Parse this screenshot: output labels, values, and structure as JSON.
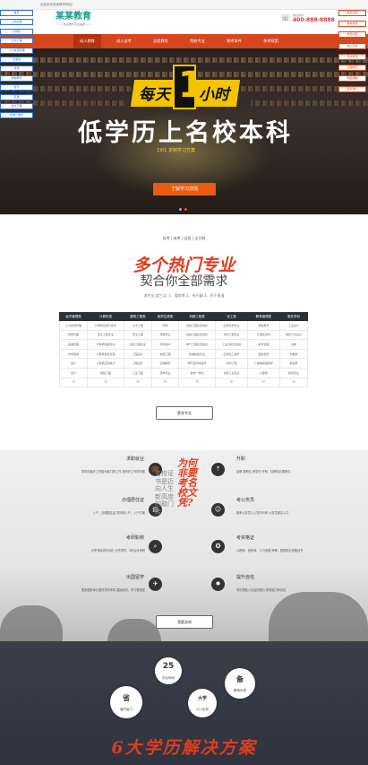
{
  "topbar": {
    "text": "欢迎来到某某教育网站!"
  },
  "header": {
    "logo_name": "某某教育",
    "logo_tagline": "—— 职业教育专业品牌 ——",
    "phone_label": "报名热线:",
    "phone_number": "400-888-8888"
  },
  "nav": {
    "items": [
      "成人教育",
      "成人自考",
      "远程教育",
      "院校专业",
      "报考条件",
      "免考政策"
    ]
  },
  "side_left": [
    "首页",
    "工商管理",
    "计算机",
    "土木工程",
    "人力资源管理",
    "汉语言",
    "法律",
    "学前教育",
    "会计",
    "英语",
    "会计工程",
    "机电一体化"
  ],
  "side_right": [
    "报名流程",
    "报考指南",
    "常见问题",
    "成人高考",
    "自学考试",
    "远程教育",
    "网络课程",
    "联系我们"
  ],
  "hero": {
    "line1a": "每天",
    "line1_one": "1",
    "line1b": "小时",
    "line2": "低学历上名校本科",
    "line3": "1对1 定制学习方案",
    "button": "了解学习详情"
  },
  "section2": {
    "sub_links": "自考 | 成考 | 远程 | 全日制",
    "title": "多个热门专业",
    "subtitle": "契合你全部需求",
    "desc": "选专业,就三点: 1、看前考 2、有兴趣 3、利于晋道",
    "headers": [
      "经济管理类",
      "计算机类",
      "建筑工程类",
      "医药生健类",
      "机械工程类",
      "化工类",
      "教育管理类",
      "更多学科"
    ],
    "rows": [
      [
        "人力资源管理",
        "计算机应用与技术",
        "土木工程",
        "药学",
        "机械工程及自动化",
        "应用化学专业",
        "学前教育",
        "工业设计"
      ],
      [
        "财务管理",
        "电子工程专业",
        "安全工程",
        "药物专业",
        "机械工程及自动化",
        "化学工程专业",
        "汉语言文学",
        "电影艺术设计"
      ],
      [
        "金融管理",
        "计算机网络专业",
        "建筑工程专业",
        "药学技术",
        "电气工程及自动化",
        "工业分析与检验",
        "教育管理",
        "法律"
      ],
      [
        "市场营销",
        "计算机信息管理",
        "工程设计",
        "制药工程",
        "机械制造专业",
        "应用化工技术",
        "国际教育",
        "护理学"
      ],
      [
        "会计",
        "计算机应用技术",
        "工程设计",
        "生物制药",
        "电气自动化技术",
        "化学工程",
        "广播电视编辑学",
        "英语学"
      ],
      [
        "会计",
        "网络工程",
        "工业工程",
        "药学专业",
        "机电一体化",
        "化学工业专业",
        "心理学",
        "新闻专业"
      ]
    ],
    "icons": [
      "⊕",
      "⊕",
      "⊕",
      "⊕",
      "⊕",
      "⊕",
      "⊕",
      "⊕"
    ],
    "button": "更多专业"
  },
  "section3": {
    "center_title": "为何非要考名校文凭?",
    "center_sub": "名校证书是迈向人生新高度的敲门砖",
    "left": [
      {
        "title": "求职就业",
        "desc": "求学的最好工作因为敲门砖工作 找份好工作的时候"
      },
      {
        "title": "办理居住证",
        "desc": "入户、办理居住证 学历和入户、入户方案"
      },
      {
        "title": "考研职称",
        "desc": "大学专科学历可在 大学学历、2年后可考研"
      },
      {
        "title": "出国留学",
        "desc": "很多国家承认国内学历本科 直接面试、学习很轻松"
      }
    ],
    "right": [
      {
        "title": "升职",
        "desc": "加薪 提职位,有学历 升职、加薪的必要条件"
      },
      {
        "title": "考公务员",
        "desc": "报考公务员以上学历可考 公务员报名入口"
      },
      {
        "title": "考资格证",
        "desc": "心理师、营养师、人力资源 师等、国家职业资格证书"
      },
      {
        "title": "提升自信",
        "desc": "学历是融入社会的基石 你的能力和自信"
      }
    ],
    "button": "我要咨询"
  },
  "section4": {
    "badges": [
      "25",
      "备",
      "省",
      "大学"
    ],
    "labels": [
      "毕业时间",
      "教育可查",
      "省时省力",
      "211名校"
    ],
    "title": "6大学历解决方案"
  }
}
